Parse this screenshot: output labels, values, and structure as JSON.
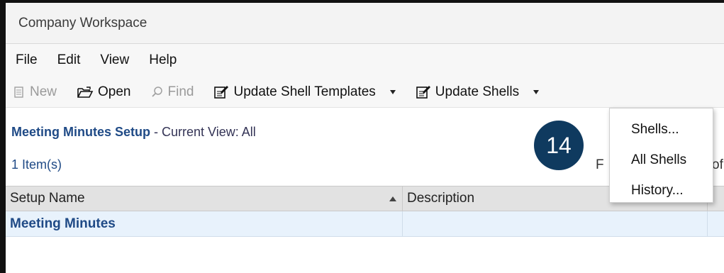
{
  "window": {
    "title": "Company Workspace"
  },
  "menubar": {
    "items": [
      {
        "label": "File"
      },
      {
        "label": "Edit"
      },
      {
        "label": "View"
      },
      {
        "label": "Help"
      }
    ]
  },
  "toolbar": {
    "new_label": "New",
    "open_label": "Open",
    "find_label": "Find",
    "update_templates_label": "Update Shell Templates",
    "update_shells_label": "Update Shells"
  },
  "header": {
    "title": "Meeting Minutes Setup",
    "view_prefix": " - Current View:  All"
  },
  "list": {
    "count_text": "1  Item(s)",
    "partial_left": "F",
    "partial_right": "of"
  },
  "table": {
    "columns": [
      {
        "label": "Setup Name"
      },
      {
        "label": "Description"
      }
    ],
    "rows": [
      {
        "name": "Meeting Minutes",
        "description": ""
      }
    ]
  },
  "badge": {
    "value": "14"
  },
  "dropdown": {
    "items": [
      {
        "label": "Shells..."
      },
      {
        "label": "All Shells"
      },
      {
        "label": "History..."
      }
    ]
  },
  "colors": {
    "accent": "#1f4a86",
    "badge": "#0f3a5f",
    "row_selected": "#e8f2fc"
  }
}
